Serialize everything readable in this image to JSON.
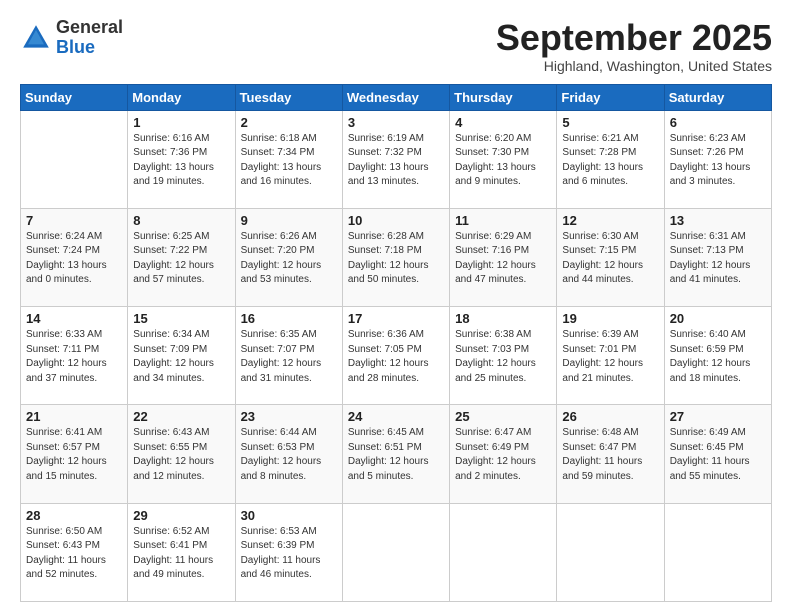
{
  "header": {
    "logo": {
      "general": "General",
      "blue": "Blue"
    },
    "month": "September 2025",
    "location": "Highland, Washington, United States"
  },
  "columns": [
    "Sunday",
    "Monday",
    "Tuesday",
    "Wednesday",
    "Thursday",
    "Friday",
    "Saturday"
  ],
  "weeks": [
    [
      {
        "day": "",
        "info": ""
      },
      {
        "day": "1",
        "info": "Sunrise: 6:16 AM\nSunset: 7:36 PM\nDaylight: 13 hours\nand 19 minutes."
      },
      {
        "day": "2",
        "info": "Sunrise: 6:18 AM\nSunset: 7:34 PM\nDaylight: 13 hours\nand 16 minutes."
      },
      {
        "day": "3",
        "info": "Sunrise: 6:19 AM\nSunset: 7:32 PM\nDaylight: 13 hours\nand 13 minutes."
      },
      {
        "day": "4",
        "info": "Sunrise: 6:20 AM\nSunset: 7:30 PM\nDaylight: 13 hours\nand 9 minutes."
      },
      {
        "day": "5",
        "info": "Sunrise: 6:21 AM\nSunset: 7:28 PM\nDaylight: 13 hours\nand 6 minutes."
      },
      {
        "day": "6",
        "info": "Sunrise: 6:23 AM\nSunset: 7:26 PM\nDaylight: 13 hours\nand 3 minutes."
      }
    ],
    [
      {
        "day": "7",
        "info": "Sunrise: 6:24 AM\nSunset: 7:24 PM\nDaylight: 13 hours\nand 0 minutes."
      },
      {
        "day": "8",
        "info": "Sunrise: 6:25 AM\nSunset: 7:22 PM\nDaylight: 12 hours\nand 57 minutes."
      },
      {
        "day": "9",
        "info": "Sunrise: 6:26 AM\nSunset: 7:20 PM\nDaylight: 12 hours\nand 53 minutes."
      },
      {
        "day": "10",
        "info": "Sunrise: 6:28 AM\nSunset: 7:18 PM\nDaylight: 12 hours\nand 50 minutes."
      },
      {
        "day": "11",
        "info": "Sunrise: 6:29 AM\nSunset: 7:16 PM\nDaylight: 12 hours\nand 47 minutes."
      },
      {
        "day": "12",
        "info": "Sunrise: 6:30 AM\nSunset: 7:15 PM\nDaylight: 12 hours\nand 44 minutes."
      },
      {
        "day": "13",
        "info": "Sunrise: 6:31 AM\nSunset: 7:13 PM\nDaylight: 12 hours\nand 41 minutes."
      }
    ],
    [
      {
        "day": "14",
        "info": "Sunrise: 6:33 AM\nSunset: 7:11 PM\nDaylight: 12 hours\nand 37 minutes."
      },
      {
        "day": "15",
        "info": "Sunrise: 6:34 AM\nSunset: 7:09 PM\nDaylight: 12 hours\nand 34 minutes."
      },
      {
        "day": "16",
        "info": "Sunrise: 6:35 AM\nSunset: 7:07 PM\nDaylight: 12 hours\nand 31 minutes."
      },
      {
        "day": "17",
        "info": "Sunrise: 6:36 AM\nSunset: 7:05 PM\nDaylight: 12 hours\nand 28 minutes."
      },
      {
        "day": "18",
        "info": "Sunrise: 6:38 AM\nSunset: 7:03 PM\nDaylight: 12 hours\nand 25 minutes."
      },
      {
        "day": "19",
        "info": "Sunrise: 6:39 AM\nSunset: 7:01 PM\nDaylight: 12 hours\nand 21 minutes."
      },
      {
        "day": "20",
        "info": "Sunrise: 6:40 AM\nSunset: 6:59 PM\nDaylight: 12 hours\nand 18 minutes."
      }
    ],
    [
      {
        "day": "21",
        "info": "Sunrise: 6:41 AM\nSunset: 6:57 PM\nDaylight: 12 hours\nand 15 minutes."
      },
      {
        "day": "22",
        "info": "Sunrise: 6:43 AM\nSunset: 6:55 PM\nDaylight: 12 hours\nand 12 minutes."
      },
      {
        "day": "23",
        "info": "Sunrise: 6:44 AM\nSunset: 6:53 PM\nDaylight: 12 hours\nand 8 minutes."
      },
      {
        "day": "24",
        "info": "Sunrise: 6:45 AM\nSunset: 6:51 PM\nDaylight: 12 hours\nand 5 minutes."
      },
      {
        "day": "25",
        "info": "Sunrise: 6:47 AM\nSunset: 6:49 PM\nDaylight: 12 hours\nand 2 minutes."
      },
      {
        "day": "26",
        "info": "Sunrise: 6:48 AM\nSunset: 6:47 PM\nDaylight: 11 hours\nand 59 minutes."
      },
      {
        "day": "27",
        "info": "Sunrise: 6:49 AM\nSunset: 6:45 PM\nDaylight: 11 hours\nand 55 minutes."
      }
    ],
    [
      {
        "day": "28",
        "info": "Sunrise: 6:50 AM\nSunset: 6:43 PM\nDaylight: 11 hours\nand 52 minutes."
      },
      {
        "day": "29",
        "info": "Sunrise: 6:52 AM\nSunset: 6:41 PM\nDaylight: 11 hours\nand 49 minutes."
      },
      {
        "day": "30",
        "info": "Sunrise: 6:53 AM\nSunset: 6:39 PM\nDaylight: 11 hours\nand 46 minutes."
      },
      {
        "day": "",
        "info": ""
      },
      {
        "day": "",
        "info": ""
      },
      {
        "day": "",
        "info": ""
      },
      {
        "day": "",
        "info": ""
      }
    ]
  ]
}
